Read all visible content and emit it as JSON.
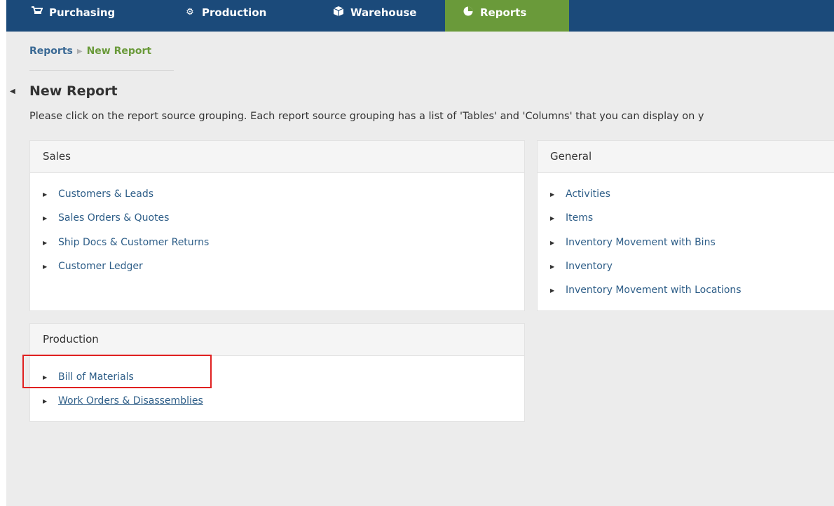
{
  "nav": {
    "items": [
      {
        "label": "Purchasing",
        "icon": "cart-icon",
        "active": false
      },
      {
        "label": "Production",
        "icon": "gears-icon",
        "active": false
      },
      {
        "label": "Warehouse",
        "icon": "box-icon",
        "active": false
      },
      {
        "label": "Reports",
        "icon": "pie-chart-icon",
        "active": true
      }
    ],
    "colors": {
      "bar": "#1b4a7a",
      "active": "#6a9a3a"
    }
  },
  "breadcrumb": {
    "root": "Reports",
    "current": "New Report"
  },
  "page": {
    "title": "New Report",
    "instructions": "Please click on the report source grouping. Each report source grouping has a list of 'Tables' and 'Columns' that you can display on y"
  },
  "panels": {
    "sales": {
      "title": "Sales",
      "items": [
        "Customers & Leads",
        "Sales Orders & Quotes",
        "Ship Docs & Customer Returns",
        "Customer Ledger"
      ]
    },
    "general": {
      "title": "General",
      "items": [
        "Activities",
        "Items",
        "Inventory Movement with Bins",
        "Inventory",
        "Inventory Movement with Locations"
      ]
    },
    "production": {
      "title": "Production",
      "items": [
        "Bill of Materials",
        "Work Orders & Disassemblies"
      ]
    }
  }
}
